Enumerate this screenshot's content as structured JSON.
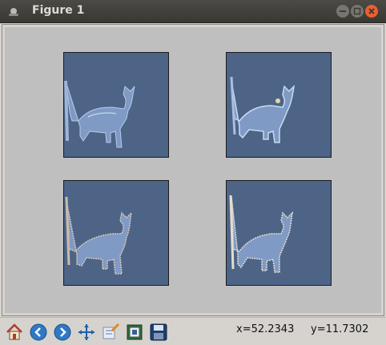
{
  "window": {
    "title": "Figure 1",
    "buttons": [
      "minimize",
      "maximize",
      "close"
    ]
  },
  "figure": {
    "background": "#bfbfbf",
    "axes_color": "#4d6487",
    "subplots": [
      {
        "content": "cat-image",
        "variant": "original"
      },
      {
        "content": "cat-image",
        "variant": "edge-highlighted"
      },
      {
        "content": "cat-image",
        "variant": "outline-back"
      },
      {
        "content": "cat-image",
        "variant": "outline-front"
      }
    ]
  },
  "toolbar": {
    "tools": [
      {
        "name": "home-icon"
      },
      {
        "name": "back-arrow-icon"
      },
      {
        "name": "forward-arrow-icon"
      },
      {
        "name": "pan-icon"
      },
      {
        "name": "zoom-icon"
      },
      {
        "name": "subplots-config-icon"
      },
      {
        "name": "save-icon"
      }
    ],
    "x_readout": "x=52.2343",
    "y_readout": "y=11.7302"
  }
}
